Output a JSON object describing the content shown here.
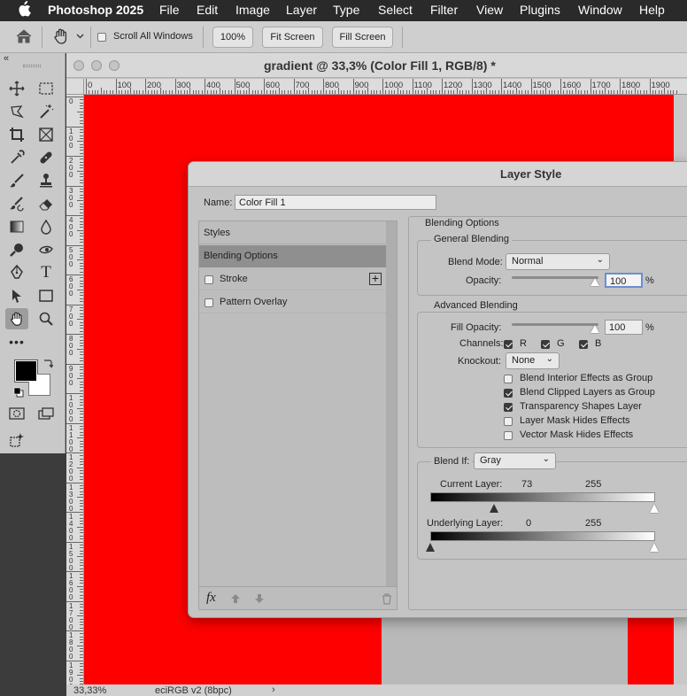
{
  "menubar": {
    "apple_icon": "apple-icon",
    "app": "Photoshop 2025",
    "items": [
      "File",
      "Edit",
      "Image",
      "Layer",
      "Type",
      "Select",
      "Filter",
      "View",
      "Plugins",
      "Window",
      "Help"
    ]
  },
  "options_bar": {
    "scroll_all_windows": "Scroll All Windows",
    "zoom_100": "100%",
    "fit_screen": "Fit Screen",
    "fill_screen": "Fill Screen"
  },
  "document": {
    "title": "gradient @ 33,3% (Color Fill 1, RGB/8) *",
    "ruler_labels": [
      "0",
      "100",
      "200",
      "300",
      "400",
      "500",
      "600",
      "700",
      "800",
      "900",
      "1000",
      "1100",
      "1200",
      "1300",
      "1400",
      "1500",
      "1600",
      "1700",
      "1800",
      "1900"
    ],
    "status_zoom": "33,33%",
    "status_profile": "eciRGB v2 (8bpc)",
    "status_arrow": "›",
    "canvas_color": "#ff0000"
  },
  "dialog": {
    "title": "Layer Style",
    "name_label": "Name:",
    "name_value": "Color Fill 1",
    "styles_header": "Styles",
    "style_items": [
      {
        "label": "Blending Options",
        "selected": true
      },
      {
        "label": "Stroke",
        "checked": false,
        "add": "+"
      },
      {
        "label": "Pattern Overlay",
        "checked": false
      }
    ],
    "footer_fx": "fx",
    "blending": {
      "section": "Blending Options",
      "general": "General Blending",
      "blend_mode_label": "Blend Mode:",
      "blend_mode": "Normal",
      "opacity_label": "Opacity:",
      "opacity": "100",
      "percent": "%",
      "advanced": "Advanced Blending",
      "fill_opacity_label": "Fill Opacity:",
      "fill_opacity": "100",
      "channels_label": "Channels:",
      "channels": [
        {
          "label": "R",
          "checked": true
        },
        {
          "label": "G",
          "checked": true
        },
        {
          "label": "B",
          "checked": true
        }
      ],
      "knockout_label": "Knockout:",
      "knockout": "None",
      "options": [
        {
          "label": "Blend Interior Effects as Group",
          "checked": false
        },
        {
          "label": "Blend Clipped Layers as Group",
          "checked": true
        },
        {
          "label": "Transparency Shapes Layer",
          "checked": true
        },
        {
          "label": "Layer Mask Hides Effects",
          "checked": false
        },
        {
          "label": "Vector Mask Hides Effects",
          "checked": false
        }
      ],
      "blend_if_label": "Blend If:",
      "blend_if": "Gray",
      "current_layer_label": "Current Layer:",
      "current_layer_low": "73",
      "current_layer_high": "255",
      "underlying_layer_label": "Underlying Layer:",
      "underlying_low": "0",
      "underlying_high": "255"
    }
  }
}
